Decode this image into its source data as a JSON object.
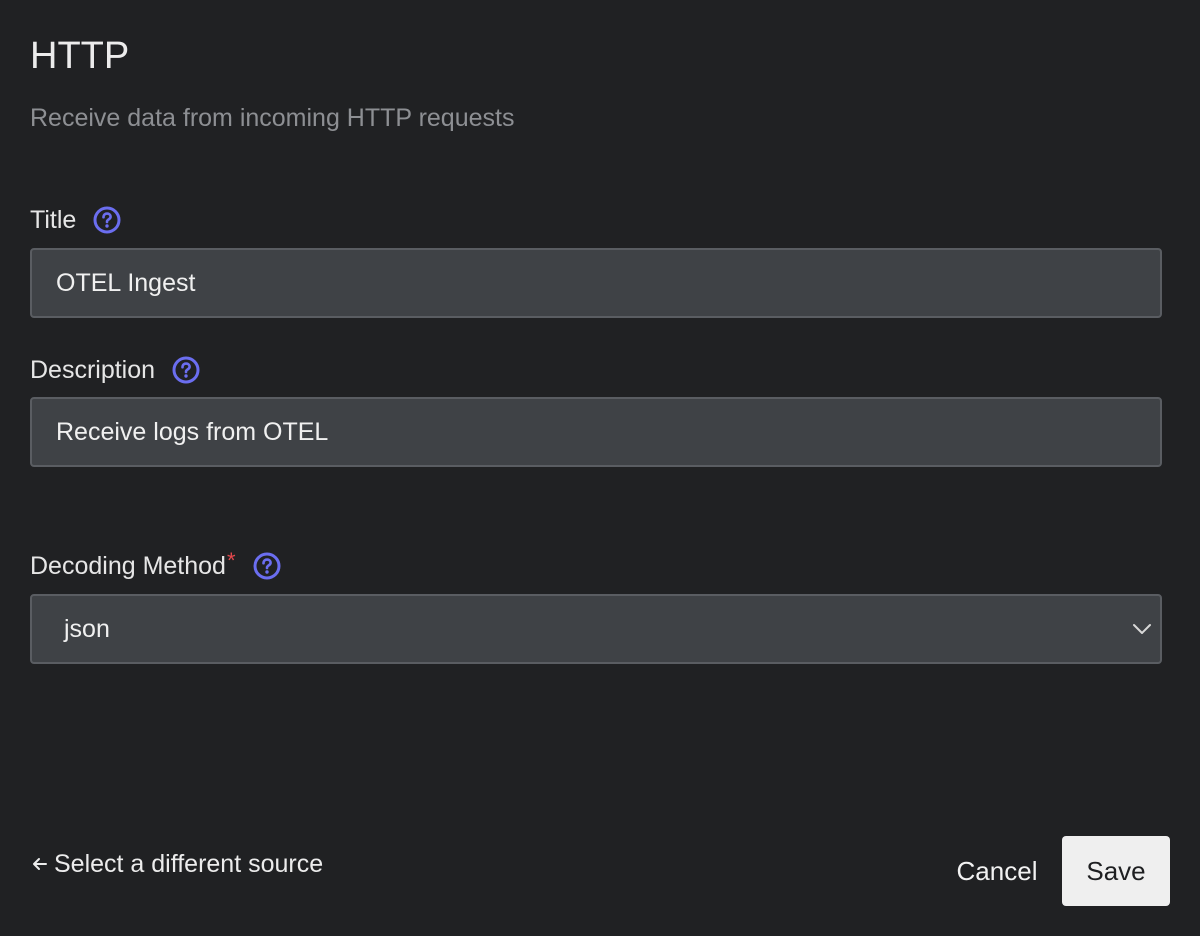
{
  "header": {
    "title": "HTTP",
    "subtitle": "Receive data from incoming HTTP requests"
  },
  "form": {
    "title_field": {
      "label": "Title",
      "value": "OTEL Ingest",
      "help_icon": "question-circle-icon"
    },
    "description_field": {
      "label": "Description",
      "value": "Receive logs from OTEL",
      "help_icon": "question-circle-icon"
    },
    "decoding_method_field": {
      "label": "Decoding Method",
      "required_marker": "*",
      "selected_value": "json",
      "help_icon": "question-circle-icon",
      "dropdown_icon": "chevron-down-icon"
    }
  },
  "footer": {
    "back_link_label": "Select a different source",
    "back_link_icon": "arrow-left-icon",
    "cancel_label": "Cancel",
    "save_label": "Save"
  },
  "colors": {
    "background": "#202123",
    "input_background": "#3f4246",
    "input_border": "#5a5d62",
    "help_icon": "#6b6ef0",
    "required_star": "#e5484d",
    "subtitle": "#8d8f93",
    "save_button_bg": "#efefef"
  }
}
